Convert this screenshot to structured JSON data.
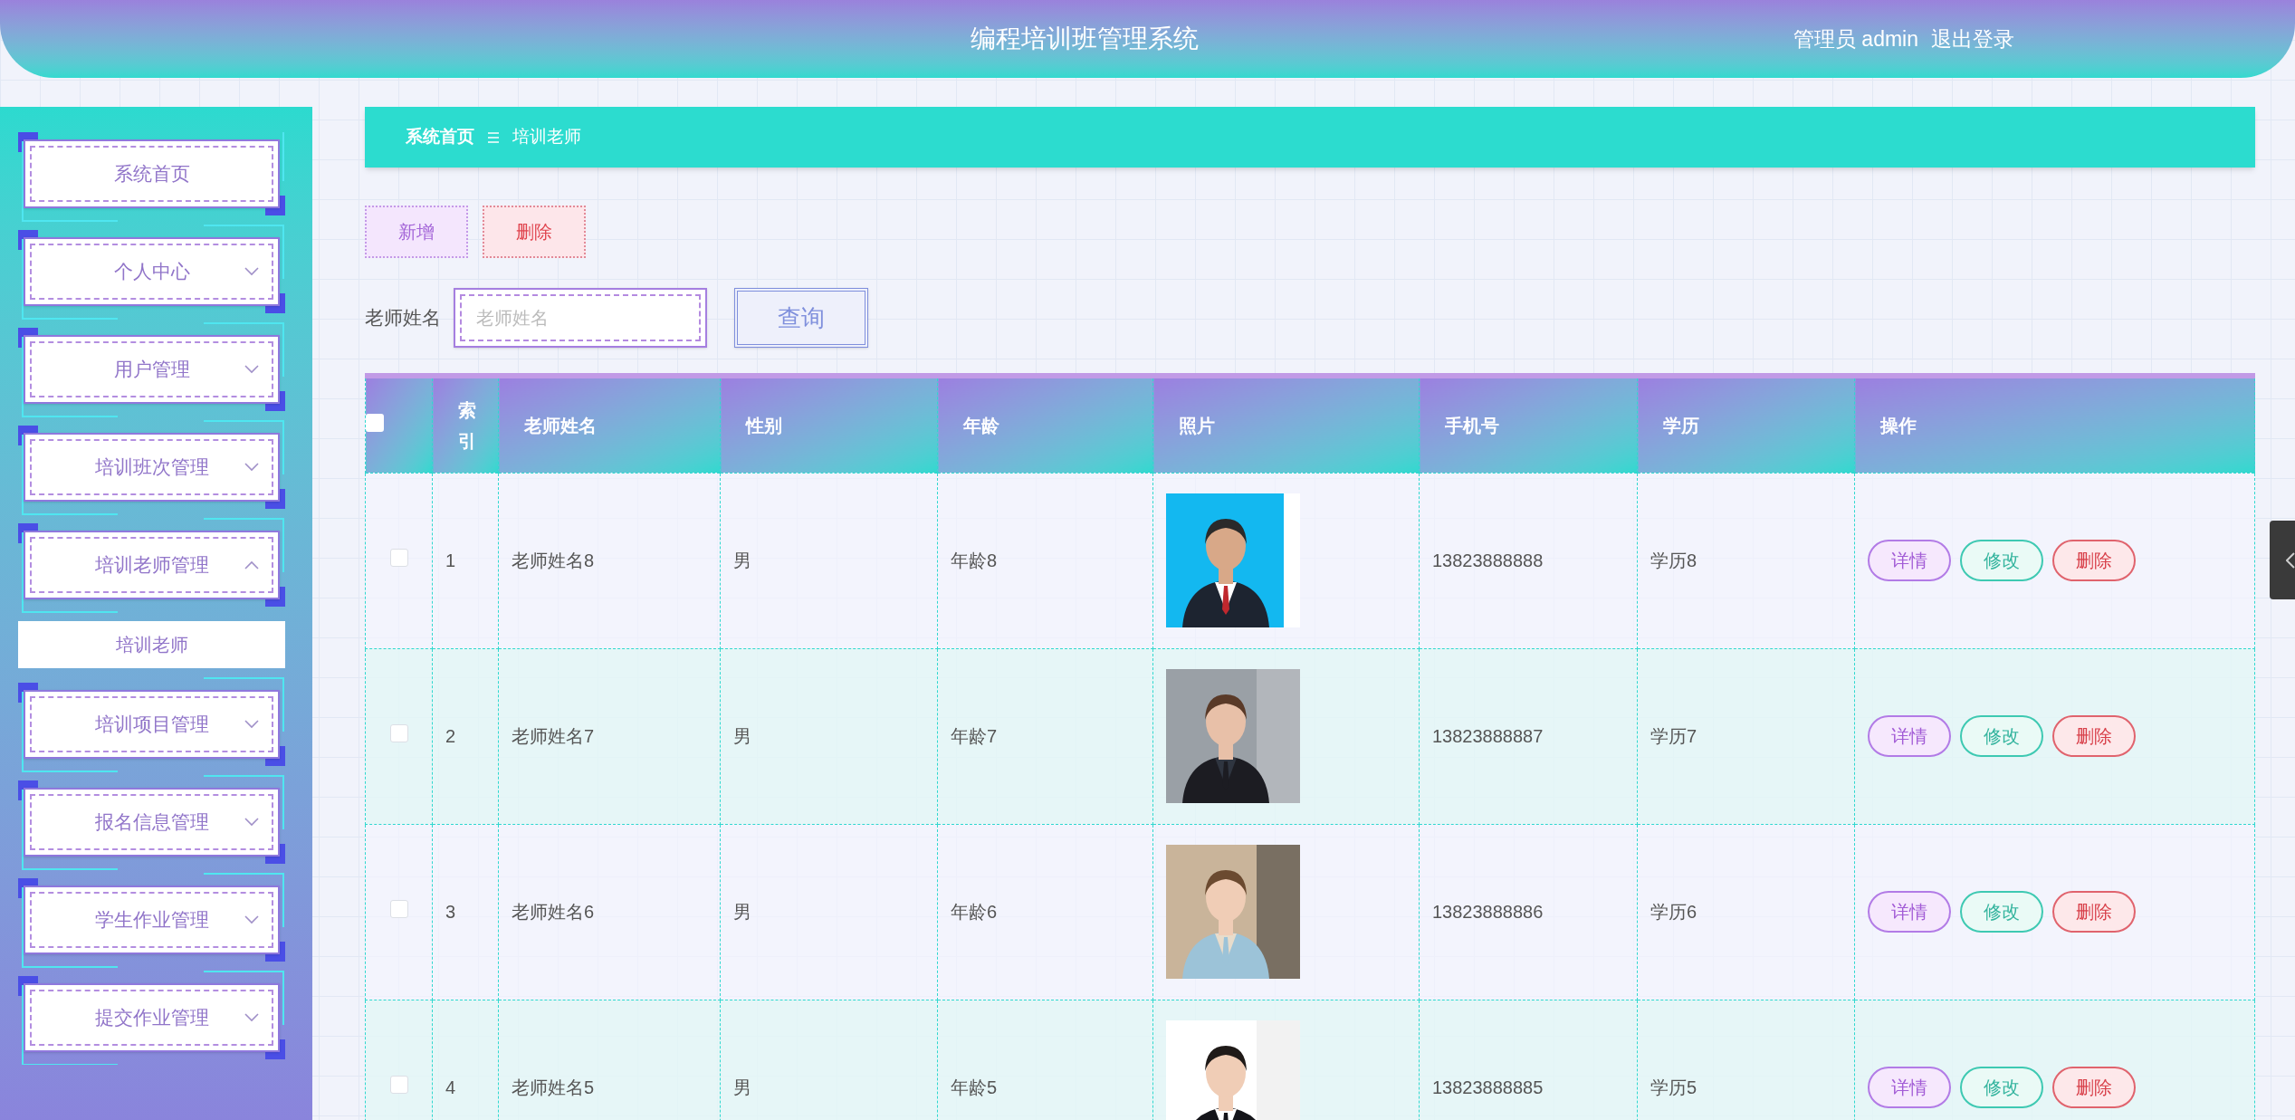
{
  "header": {
    "title": "编程培训班管理系统",
    "user": "管理员 admin",
    "logout": "退出登录"
  },
  "sidebar": {
    "items": [
      {
        "label": "系统首页",
        "kind": "link"
      },
      {
        "label": "个人中心",
        "kind": "menu",
        "expanded": false
      },
      {
        "label": "用户管理",
        "kind": "menu",
        "expanded": false
      },
      {
        "label": "培训班次管理",
        "kind": "menu",
        "expanded": false
      },
      {
        "label": "培训老师管理",
        "kind": "menu",
        "expanded": true,
        "children": [
          {
            "label": "培训老师",
            "selected": true
          }
        ]
      },
      {
        "label": "培训项目管理",
        "kind": "menu",
        "expanded": false
      },
      {
        "label": "报名信息管理",
        "kind": "menu",
        "expanded": false
      },
      {
        "label": "学生作业管理",
        "kind": "menu",
        "expanded": false
      },
      {
        "label": "提交作业管理",
        "kind": "menu",
        "expanded": false
      }
    ]
  },
  "breadcrumb": [
    "系统首页",
    "培训老师"
  ],
  "actions": [
    {
      "label": "新增",
      "kind": "add"
    },
    {
      "label": "删除",
      "kind": "delete"
    }
  ],
  "search": {
    "label": "老师姓名",
    "placeholder": "老师姓名",
    "button": "查询"
  },
  "table": {
    "select_all_checked": false,
    "columns": [
      "索引",
      "老师姓名",
      "性别",
      "年龄",
      "照片",
      "手机号",
      "学历",
      "操作"
    ],
    "rows": [
      {
        "checked": false,
        "index": "1",
        "name": "老师姓名8",
        "gender": "男",
        "age": "年龄8",
        "photo": {
          "kind": "picture"
        },
        "phone": "13823888888",
        "education": "学历8",
        "actions": [
          {
            "label": "详情",
            "kind": "detail"
          },
          {
            "label": "修改",
            "kind": "edit"
          },
          {
            "label": "删除",
            "kind": "delete"
          }
        ]
      },
      {
        "checked": false,
        "index": "2",
        "name": "老师姓名7",
        "gender": "男",
        "age": "年龄7",
        "photo": {
          "kind": "picture"
        },
        "phone": "13823888887",
        "education": "学历7",
        "actions": [
          {
            "label": "详情",
            "kind": "detail"
          },
          {
            "label": "修改",
            "kind": "edit"
          },
          {
            "label": "删除",
            "kind": "delete"
          }
        ]
      },
      {
        "checked": false,
        "index": "3",
        "name": "老师姓名6",
        "gender": "男",
        "age": "年龄6",
        "photo": {
          "kind": "picture"
        },
        "phone": "13823888886",
        "education": "学历6",
        "actions": [
          {
            "label": "详情",
            "kind": "detail"
          },
          {
            "label": "修改",
            "kind": "edit"
          },
          {
            "label": "删除",
            "kind": "delete"
          }
        ]
      },
      {
        "checked": false,
        "index": "4",
        "name": "老师姓名5",
        "gender": "男",
        "age": "年龄5",
        "photo": {
          "kind": "picture"
        },
        "phone": "13823888885",
        "education": "学历5",
        "actions": [
          {
            "label": "详情",
            "kind": "detail"
          },
          {
            "label": "修改",
            "kind": "edit"
          },
          {
            "label": "删除",
            "kind": "delete"
          }
        ]
      }
    ]
  }
}
